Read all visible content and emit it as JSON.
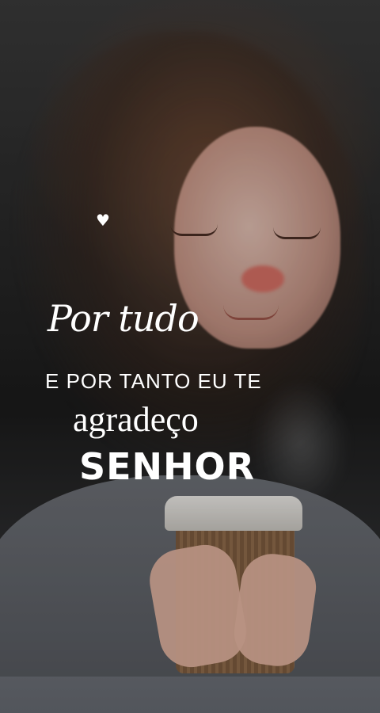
{
  "decoration": {
    "heart_icon": "heart-icon"
  },
  "text": {
    "line1": "Por tudo",
    "line2": "E POR TANTO EU TE",
    "line3": "agradeço",
    "line4": "SENHOR"
  }
}
